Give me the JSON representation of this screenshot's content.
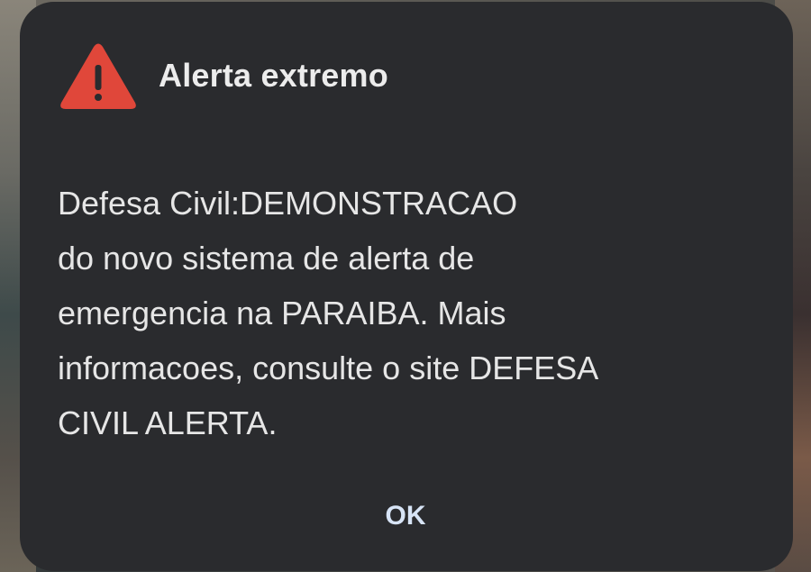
{
  "alert": {
    "title": "Alerta extremo",
    "icon": "warning-triangle-icon",
    "icon_color": "#e0473a",
    "message": "Defesa Civil:DEMONSTRACAO\ndo novo sistema de alerta de\nemergencia na PARAIBA. Mais\ninformacoes, consulte o site DEFESA\nCIVIL ALERTA.",
    "ok_label": "OK"
  }
}
